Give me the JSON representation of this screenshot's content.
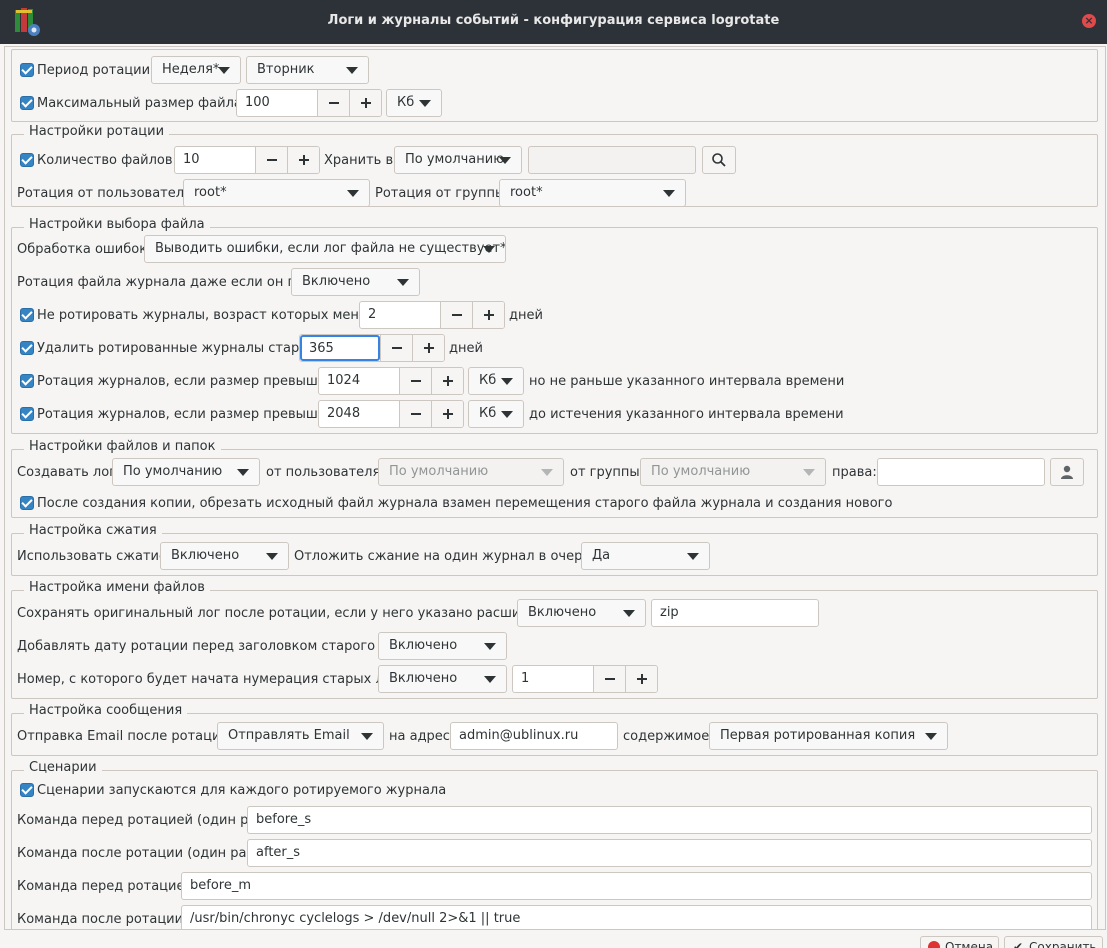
{
  "window": {
    "title": "Логи и журналы событий - конфигурация сервиса logrotate"
  },
  "top": {
    "period_label": "Период ротации:",
    "period_value": "Неделя*",
    "weekday_value": "Вторник",
    "maxsize_label": "Максимальный размер файла:",
    "maxsize_value": "100",
    "maxsize_unit": "Кб"
  },
  "rotation": {
    "legend": "Настройки ротации",
    "count_label": "Количество файлов:",
    "count_value": "10",
    "store_label": "Хранить в:",
    "store_value": "По умолчанию",
    "store_path": "",
    "user_label": "Ротация от пользователя:",
    "user_value": "root*",
    "group_label": "Ротация от группы:",
    "group_value": "root*"
  },
  "file_select": {
    "legend": "Настройки выбора файла",
    "errors_label": "Обработка ошибок:",
    "errors_value": "Выводить ошибки, если лог файла не существует*",
    "empty_label": "Ротация файла журнала даже если он пуст:",
    "empty_value": "Включено",
    "minage_label": "Не ротировать журналы, возраст которых меньше",
    "minage_value": "2",
    "minage_unit": "дней",
    "maxage_label": "Удалить ротированные журналы старше",
    "maxage_value": "365",
    "maxage_unit": "дней",
    "minsize_label": "Ротация журналов, если размер превышает",
    "minsize_value": "1024",
    "minsize_unit": "Кб",
    "minsize_note": "но не раньше указанного интервала времени",
    "maxsize2_label": "Ротация журналов, если размер превышает",
    "maxsize2_value": "2048",
    "maxsize2_unit": "Кб",
    "maxsize2_note": "до истечения указанного интервала времени"
  },
  "files_folders": {
    "legend": "Настройки файлов и папок",
    "create_label": "Создавать лог",
    "create_value": "По умолчанию",
    "from_user_label": "от пользователя:",
    "from_user_value": "По умолчанию",
    "from_group_label": "от группы:",
    "from_group_value": "По умолчанию",
    "rights_label": "права:",
    "rights_value": "",
    "copytruncate_label": "После создания копии, обрезать исходный файл журнала взамен перемещения старого файла журнала и создания нового"
  },
  "compression": {
    "legend": "Настройка сжатия",
    "use_label": "Использовать сжатие:",
    "use_value": "Включено",
    "delay_label": "Отложить сжание на один журнал в очереди:",
    "delay_value": "Да"
  },
  "naming": {
    "legend": "Настройка имени файлов",
    "ext_label": "Сохранять оригинальный лог после ротации, если у него указано расширение:",
    "ext_value": "Включено",
    "ext_text": "zip",
    "date_label": "Добавлять дату ротации перед заголовком старого лога:",
    "date_value": "Включено",
    "start_label": "Номер, с которого будет начата нумерация старых логов:",
    "start_value": "Включено",
    "start_number": "1"
  },
  "message": {
    "legend": "Настройка сообщения",
    "email_label": "Отправка Email после ротации:",
    "email_value": "Отправлять Email",
    "address_label": "на адрес:",
    "address_value": "admin@ublinux.ru",
    "content_label": "содержимое:",
    "content_value": "Первая ротированная копия"
  },
  "scripts": {
    "legend": "Сценарии",
    "each_label": "Сценарии запускаются для каждого ротируемого журнала",
    "pre_once_label": "Команда перед ротацией (один раз):",
    "pre_once_value": "before_s",
    "post_once_label": "Команда после ротации (один раз):",
    "post_once_value": "after_s",
    "pre_label": "Команда перед ротацией:",
    "pre_value": "before_m",
    "post_label": "Команда после ротации:",
    "post_value": "/usr/bin/chronyc cyclelogs > /dev/null 2>&1 || true"
  },
  "footer": {
    "cancel_label": "Отмена",
    "save_label": "Сохранить"
  },
  "colors": {
    "titlebar": "#2d3238",
    "accent": "#3584e4",
    "checkbox": "#3584c4",
    "close": "#e04a4a"
  }
}
